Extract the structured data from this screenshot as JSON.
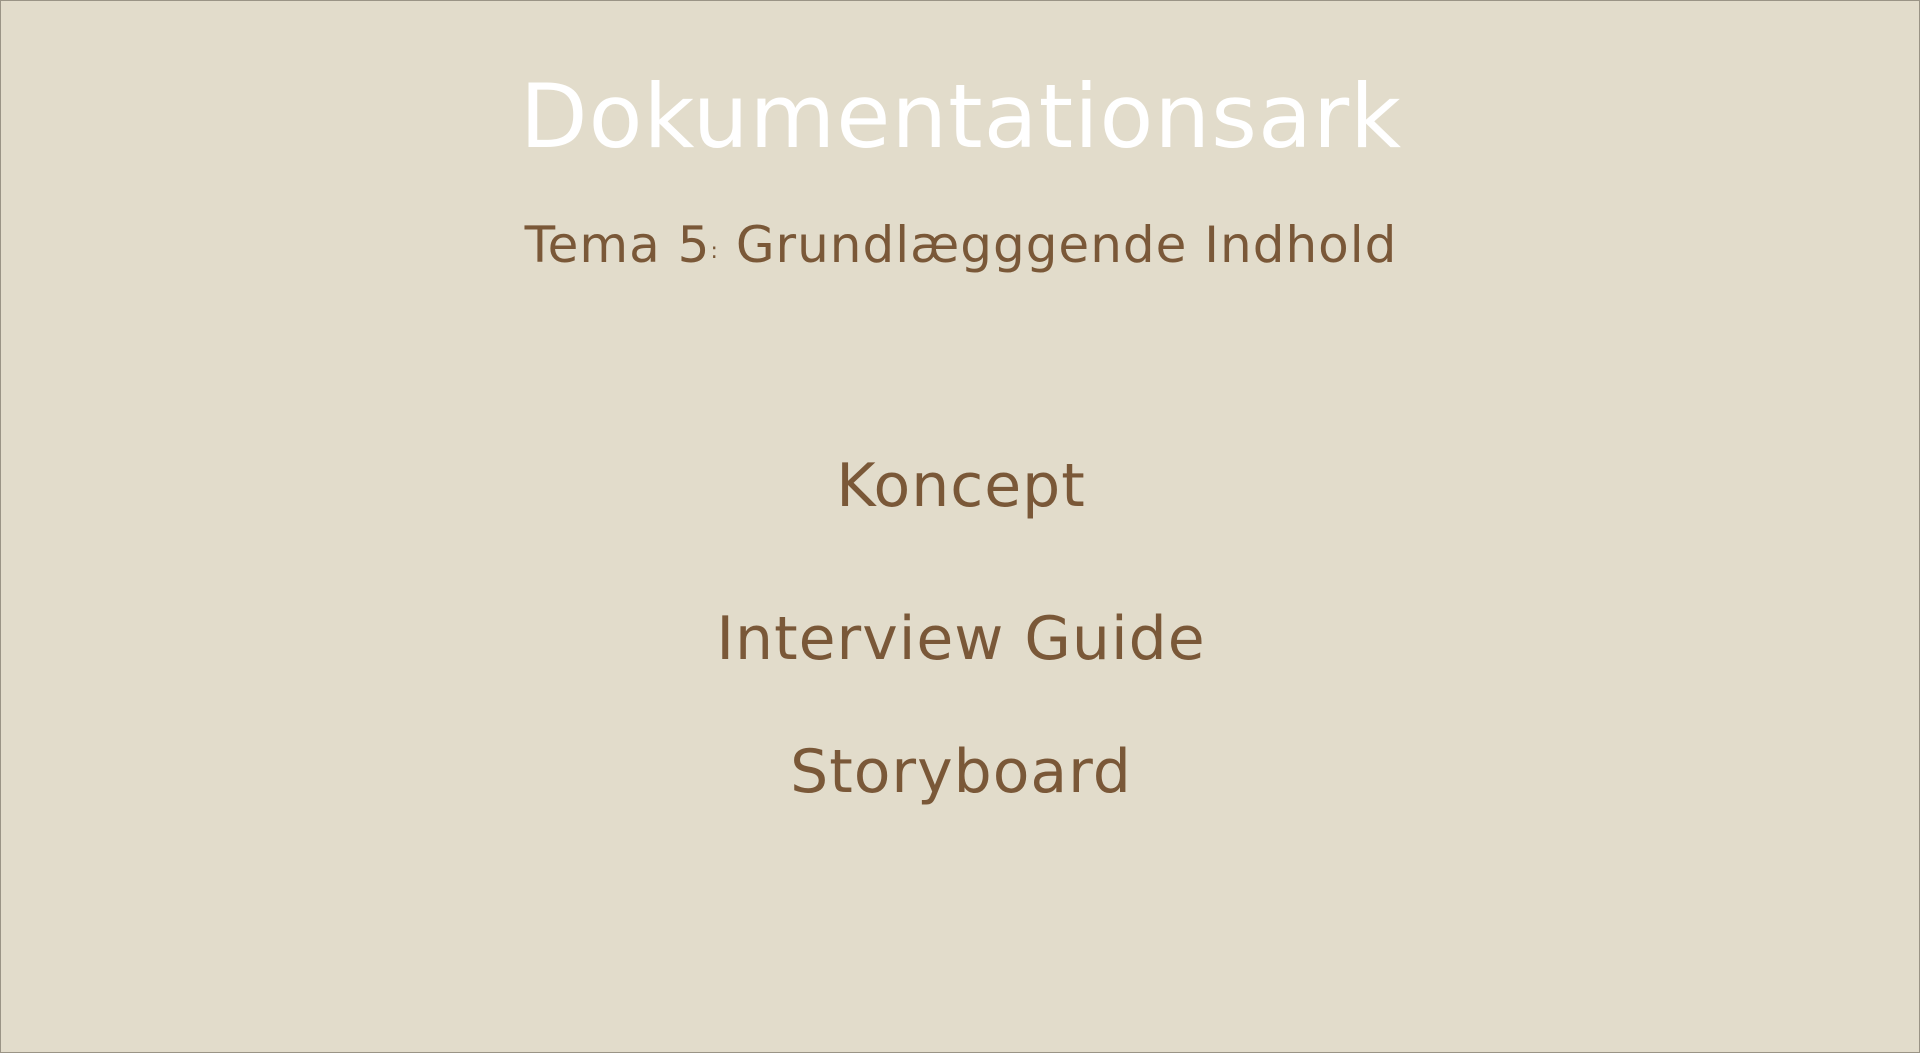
{
  "slide": {
    "title": "Dokumentationsark",
    "subtitle_prefix": "Tema 5",
    "subtitle_separator": ":",
    "subtitle_text": "Grundlægggende Indhold",
    "items": [
      {
        "label": "Koncept"
      },
      {
        "label": "Interview Guide"
      },
      {
        "label": "Storyboard"
      }
    ]
  },
  "colors": {
    "background": "#e2dccb",
    "title": "#ffffff",
    "text": "#7a5838"
  }
}
